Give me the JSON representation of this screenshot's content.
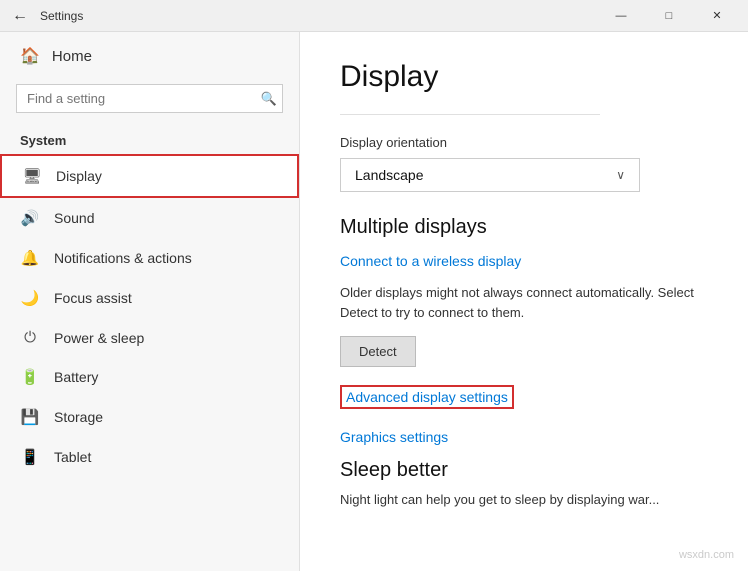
{
  "titlebar": {
    "back_label": "←",
    "title": "Settings",
    "minimize_label": "—",
    "maximize_label": "□",
    "close_label": "✕"
  },
  "sidebar": {
    "home_label": "Home",
    "search_placeholder": "Find a setting",
    "section_title": "System",
    "items": [
      {
        "id": "display",
        "icon": "🖥",
        "label": "Display",
        "active": true
      },
      {
        "id": "sound",
        "icon": "🔊",
        "label": "Sound",
        "active": false
      },
      {
        "id": "notifications",
        "icon": "🔔",
        "label": "Notifications & actions",
        "active": false
      },
      {
        "id": "focus",
        "icon": "🌙",
        "label": "Focus assist",
        "active": false
      },
      {
        "id": "power",
        "icon": "⏻",
        "label": "Power & sleep",
        "active": false
      },
      {
        "id": "battery",
        "icon": "🔋",
        "label": "Battery",
        "active": false
      },
      {
        "id": "storage",
        "icon": "💾",
        "label": "Storage",
        "active": false
      },
      {
        "id": "tablet",
        "icon": "📱",
        "label": "Tablet",
        "active": false
      }
    ]
  },
  "content": {
    "page_title": "Display",
    "orientation_label": "Display orientation",
    "orientation_value": "Landscape",
    "multiple_displays_title": "Multiple displays",
    "connect_wireless_label": "Connect to a wireless display",
    "info_text": "Older displays might not always connect automatically. Select Detect to try to connect to them.",
    "detect_btn_label": "Detect",
    "advanced_settings_label": "Advanced display settings",
    "graphics_settings_label": "Graphics settings",
    "sleep_title": "Sleep better",
    "sleep_info": "Night light can help you get to sleep by displaying war..."
  },
  "watermark": "wsxdn.com"
}
